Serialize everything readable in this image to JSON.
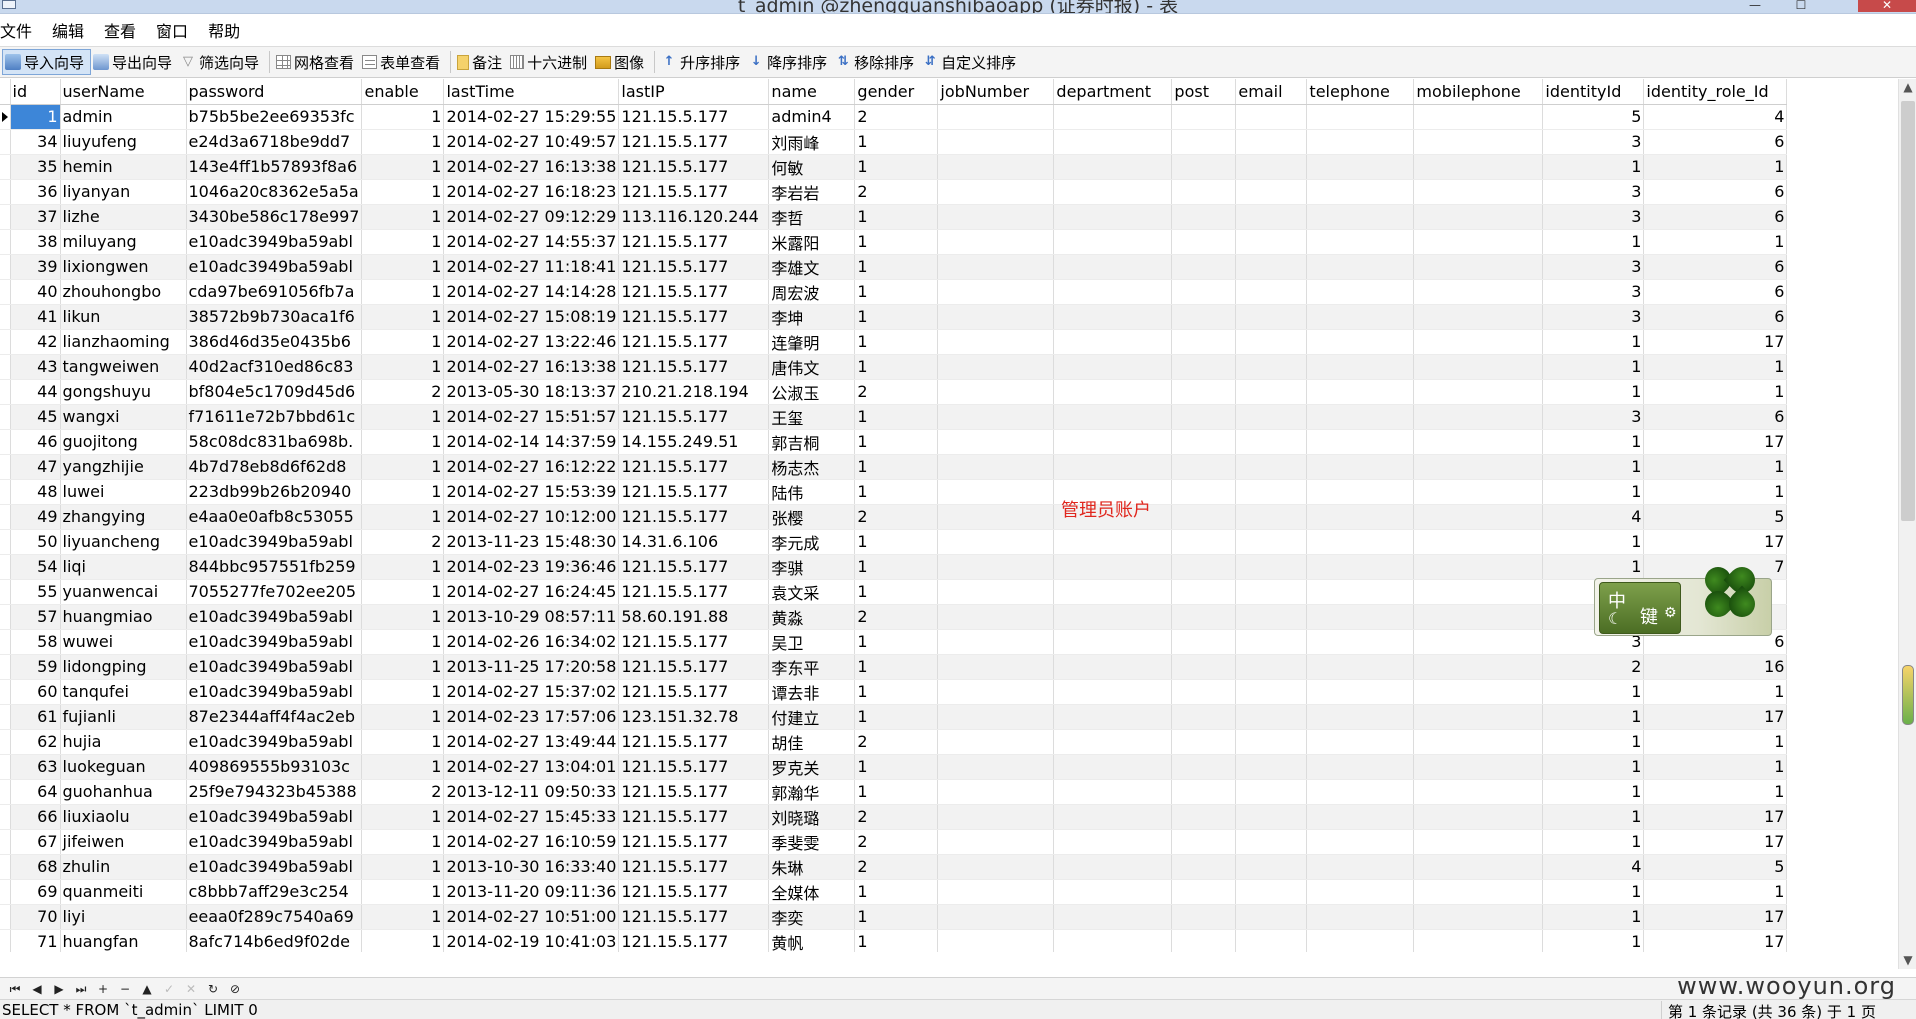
{
  "window": {
    "title": "t_admin @zhengquanshibaoapp (证券时报) - 表",
    "min": "—",
    "max": "☐",
    "close": "✕"
  },
  "menu": [
    "文件",
    "编辑",
    "查看",
    "窗口",
    "帮助"
  ],
  "toolbar": {
    "import": "导入向导",
    "export": "导出向导",
    "filter": "筛选向导",
    "grid_view": "网格查看",
    "form_view": "表单查看",
    "note": "备注",
    "hex": "十六进制",
    "image": "图像",
    "sort_asc": "升序排序",
    "sort_desc": "降序排序",
    "remove_sort": "移除排序",
    "custom_sort": "自定义排序"
  },
  "columns": [
    "id",
    "userName",
    "password",
    "enable",
    "lastTime",
    "lastIP",
    "name",
    "gender",
    "jobNumber",
    "department",
    "post",
    "email",
    "telephone",
    "mobilephone",
    "identityId",
    "identity_role_Id"
  ],
  "rows": [
    [
      "1",
      "admin",
      "b75b5be2ee69353fc",
      "1",
      "2014-02-27 15:29:55",
      "121.15.5.177",
      "admin4",
      "2",
      "",
      "",
      "",
      "",
      "",
      "",
      "5",
      "4"
    ],
    [
      "34",
      "liuyufeng",
      "e24d3a6718be9dd7",
      "1",
      "2014-02-27 10:49:57",
      "121.15.5.177",
      "刘雨峰",
      "1",
      "",
      "",
      "",
      "",
      "",
      "",
      "3",
      "6"
    ],
    [
      "35",
      "hemin",
      "143e4ff1b57893f8a6",
      "1",
      "2014-02-27 16:13:38",
      "121.15.5.177",
      "何敏",
      "1",
      "",
      "",
      "",
      "",
      "",
      "",
      "1",
      "1"
    ],
    [
      "36",
      "liyanyan",
      "1046a20c8362e5a5a",
      "1",
      "2014-02-27 16:18:23",
      "121.15.5.177",
      "李岩岩",
      "2",
      "",
      "",
      "",
      "",
      "",
      "",
      "3",
      "6"
    ],
    [
      "37",
      "lizhe",
      "3430be586c178e997",
      "1",
      "2014-02-27 09:12:29",
      "113.116.120.244",
      "李哲",
      "1",
      "",
      "",
      "",
      "",
      "",
      "",
      "3",
      "6"
    ],
    [
      "38",
      "miluyang",
      "e10adc3949ba59abl",
      "1",
      "2014-02-27 14:55:37",
      "121.15.5.177",
      "米露阳",
      "1",
      "",
      "",
      "",
      "",
      "",
      "",
      "1",
      "1"
    ],
    [
      "39",
      "lixiongwen",
      "e10adc3949ba59abl",
      "1",
      "2014-02-27 11:18:41",
      "121.15.5.177",
      "李雄文",
      "1",
      "",
      "",
      "",
      "",
      "",
      "",
      "3",
      "6"
    ],
    [
      "40",
      "zhouhongbo",
      "cda97be691056fb7a",
      "1",
      "2014-02-27 14:14:28",
      "121.15.5.177",
      "周宏波",
      "1",
      "",
      "",
      "",
      "",
      "",
      "",
      "3",
      "6"
    ],
    [
      "41",
      "likun",
      "38572b9b730aca1f6",
      "1",
      "2014-02-27 15:08:19",
      "121.15.5.177",
      "李坤",
      "1",
      "",
      "",
      "",
      "",
      "",
      "",
      "3",
      "6"
    ],
    [
      "42",
      "lianzhaoming",
      "386d46d35e0435b6",
      "1",
      "2014-02-27 13:22:46",
      "121.15.5.177",
      "连肇明",
      "1",
      "",
      "",
      "",
      "",
      "",
      "",
      "1",
      "17"
    ],
    [
      "43",
      "tangweiwen",
      "40d2acf310ed86c83",
      "1",
      "2014-02-27 16:13:38",
      "121.15.5.177",
      "唐伟文",
      "1",
      "",
      "",
      "",
      "",
      "",
      "",
      "1",
      "1"
    ],
    [
      "44",
      "gongshuyu",
      "bf804e5c1709d45d6",
      "2",
      "2013-05-30 18:13:37",
      "210.21.218.194",
      "公淑玉",
      "2",
      "",
      "",
      "",
      "",
      "",
      "",
      "1",
      "1"
    ],
    [
      "45",
      "wangxi",
      "f71611e72b7bbd61c",
      "1",
      "2014-02-27 15:51:57",
      "121.15.5.177",
      "王玺",
      "1",
      "",
      "",
      "",
      "",
      "",
      "",
      "3",
      "6"
    ],
    [
      "46",
      "guojitong",
      "58c08dc831ba698b.",
      "1",
      "2014-02-14 14:37:59",
      "14.155.249.51",
      "郭吉桐",
      "1",
      "",
      "",
      "",
      "",
      "",
      "",
      "1",
      "17"
    ],
    [
      "47",
      "yangzhijie",
      "4b7d78eb8d6f62d8",
      "1",
      "2014-02-27 16:12:22",
      "121.15.5.177",
      "杨志杰",
      "1",
      "",
      "",
      "",
      "",
      "",
      "",
      "1",
      "1"
    ],
    [
      "48",
      "luwei",
      "223db99b26b20940",
      "1",
      "2014-02-27 15:53:39",
      "121.15.5.177",
      "陆伟",
      "1",
      "",
      "",
      "",
      "",
      "",
      "",
      "1",
      "1"
    ],
    [
      "49",
      "zhangying",
      "e4aa0e0afb8c53055",
      "1",
      "2014-02-27 10:12:00",
      "121.15.5.177",
      "张樱",
      "2",
      "",
      "",
      "",
      "",
      "",
      "",
      "4",
      "5"
    ],
    [
      "50",
      "liyuancheng",
      "e10adc3949ba59abl",
      "2",
      "2013-11-23 15:48:30",
      "14.31.6.106",
      "李元成",
      "1",
      "",
      "",
      "",
      "",
      "",
      "",
      "1",
      "17"
    ],
    [
      "54",
      "liqi",
      "844bbc957551fb259",
      "1",
      "2014-02-23 19:36:46",
      "121.15.5.177",
      "李骐",
      "1",
      "",
      "",
      "",
      "",
      "",
      "",
      "1",
      "7"
    ],
    [
      "55",
      "yuanwencai",
      "7055277fe702ee205",
      "1",
      "2014-02-27 16:24:45",
      "121.15.5.177",
      "袁文采",
      "1",
      "",
      "",
      "",
      "",
      "",
      "",
      "1",
      ""
    ],
    [
      "57",
      "huangmiao",
      "e10adc3949ba59abl",
      "1",
      "2013-10-29 08:57:11",
      "58.60.191.88",
      "黄淼",
      "2",
      "",
      "",
      "",
      "",
      "",
      "",
      "1",
      ""
    ],
    [
      "58",
      "wuwei",
      "e10adc3949ba59abl",
      "1",
      "2014-02-26 16:34:02",
      "121.15.5.177",
      "吴卫",
      "1",
      "",
      "",
      "",
      "",
      "",
      "",
      "3",
      "6"
    ],
    [
      "59",
      "lidongping",
      "e10adc3949ba59abl",
      "1",
      "2013-11-25 17:20:58",
      "121.15.5.177",
      "李东平",
      "1",
      "",
      "",
      "",
      "",
      "",
      "",
      "2",
      "16"
    ],
    [
      "60",
      "tanqufei",
      "e10adc3949ba59abl",
      "1",
      "2014-02-27 15:37:02",
      "121.15.5.177",
      "谭去非",
      "1",
      "",
      "",
      "",
      "",
      "",
      "",
      "1",
      "1"
    ],
    [
      "61",
      "fujianli",
      "87e2344aff4f4ac2eb",
      "1",
      "2014-02-23 17:57:06",
      "123.151.32.78",
      "付建立",
      "1",
      "",
      "",
      "",
      "",
      "",
      "",
      "1",
      "17"
    ],
    [
      "62",
      "hujia",
      "e10adc3949ba59abl",
      "1",
      "2014-02-27 13:49:44",
      "121.15.5.177",
      "胡佳",
      "2",
      "",
      "",
      "",
      "",
      "",
      "",
      "1",
      "1"
    ],
    [
      "63",
      "luokeguan",
      "409869555b93103c",
      "1",
      "2014-02-27 13:04:01",
      "121.15.5.177",
      "罗克关",
      "1",
      "",
      "",
      "",
      "",
      "",
      "",
      "1",
      "1"
    ],
    [
      "64",
      "guohanhua",
      "25f9e794323b45388",
      "2",
      "2013-12-11 09:50:33",
      "121.15.5.177",
      "郭瀚华",
      "1",
      "",
      "",
      "",
      "",
      "",
      "",
      "1",
      "1"
    ],
    [
      "66",
      "liuxiaolu",
      "e10adc3949ba59abl",
      "1",
      "2014-02-27 15:45:33",
      "121.15.5.177",
      "刘晓璐",
      "2",
      "",
      "",
      "",
      "",
      "",
      "",
      "1",
      "17"
    ],
    [
      "67",
      "jifeiwen",
      "e10adc3949ba59abl",
      "1",
      "2014-02-27 16:10:59",
      "121.15.5.177",
      "季斐雯",
      "2",
      "",
      "",
      "",
      "",
      "",
      "",
      "1",
      "17"
    ],
    [
      "68",
      "zhulin",
      "e10adc3949ba59abl",
      "1",
      "2013-10-30 16:33:40",
      "121.15.5.177",
      "朱琳",
      "2",
      "",
      "",
      "",
      "",
      "",
      "",
      "4",
      "5"
    ],
    [
      "69",
      "quanmeiti",
      "c8bbb7aff29e3c254",
      "1",
      "2013-11-20 09:11:36",
      "121.15.5.177",
      "全媒体",
      "1",
      "",
      "",
      "",
      "",
      "",
      "",
      "1",
      "1"
    ],
    [
      "70",
      "liyi",
      "eeaa0f289c7540a69",
      "1",
      "2014-02-27 10:51:00",
      "121.15.5.177",
      "李奕",
      "1",
      "",
      "",
      "",
      "",
      "",
      "",
      "1",
      "17"
    ],
    [
      "71",
      "huangfan",
      "8afc714b6ed9f02de",
      "1",
      "2014-02-19 10:41:03",
      "121.15.5.177",
      "黄帆",
      "1",
      "",
      "",
      "",
      "",
      "",
      "",
      "1",
      "17"
    ]
  ],
  "annotation": "管理员账户",
  "ime": {
    "zh": "中",
    "jian": "键",
    "moon": "☾",
    "gear": "⚙"
  },
  "navigator": [
    "⏮",
    "◀",
    "▶",
    "⏭",
    "+",
    "−",
    "▲",
    "✓",
    "✕",
    "↻",
    "⊘"
  ],
  "watermark": "www.wooyun.org",
  "status": {
    "sql": "SELECT * FROM `t_admin` LIMIT 0",
    "records": "第 1 条记录 (共 36 条) 于 1 页"
  }
}
